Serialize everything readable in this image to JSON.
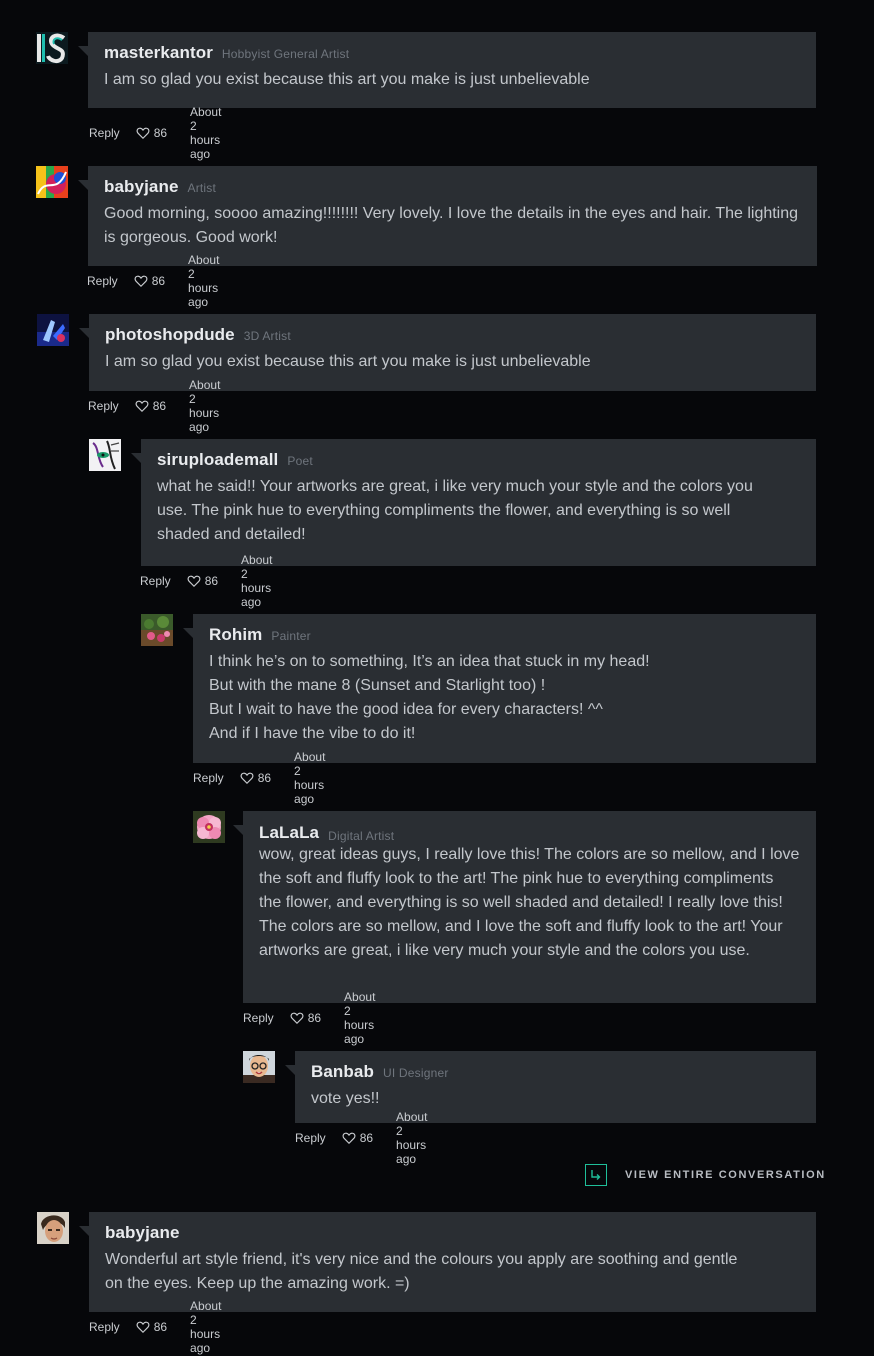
{
  "comments": [
    {
      "username": "masterkantor",
      "role": "Hobbyist General Artist",
      "text": "I am so glad you exist because this art you make is just unbelievable",
      "reply_label": "Reply",
      "likes": "86",
      "time": "About 2 hours ago",
      "avatar": "ls-logo-avatar"
    },
    {
      "username": "babyjane",
      "role": "Artist",
      "text": "Good morning, soooo amazing!!!!!!!! Very lovely.  I love the details in the eyes and hair. The lighting is gorgeous. Good work!",
      "reply_label": "Reply",
      "likes": "86",
      "time": "About 2 hours ago",
      "avatar": "rainbow-avatar"
    },
    {
      "username": "photoshopdude",
      "role": "3D Artist",
      "text": "I am so glad you exist because this art you make is just unbelievable",
      "reply_label": "Reply",
      "likes": "86",
      "time": "About 2 hours ago",
      "avatar": "blue-art-avatar"
    },
    {
      "username": "siruploadema ll",
      "role": "Poet",
      "text": "what he said!! Your artworks are great, i like very much your style and the colors you use. The pink hue to everything compliments the flower, and everything is so well shaded and detailed!",
      "reply_label": "Reply",
      "likes": "86",
      "time": "About 2 hours ago",
      "avatar": "sketch-face-avatar"
    },
    {
      "username": "Rohim",
      "role": "Painter",
      "text": "I think he’s on to something, It’s an idea that stuck in my head!\nBut with the mane 8 (Sunset and Starlight too) !\nBut I wait to have the good idea for every characters! ^^\nAnd if I have the vibe to do it!",
      "reply_label": "Reply",
      "likes": "86",
      "time": "About 2 hours ago",
      "avatar": "flowers-avatar"
    },
    {
      "username": "LaLaLa",
      "role": "Digital Artist",
      "text": "wow, great ideas guys, I really love this! The colors are so mellow, and I love the soft and fluffy look to the art! The pink hue to everything compliments the flower, and everything is so well shaded and detailed! I really love this! The colors are so mellow, and I love the soft and fluffy look to the art! Your artworks are great, i like very much your style and the colors you use.",
      "reply_label": "Reply",
      "likes": "86",
      "time": "About 2 hours ago",
      "avatar": "pink-flower-avatar"
    },
    {
      "username": "Banbab",
      "role": "UI Designer",
      "text": "vote yes!!",
      "reply_label": "Reply",
      "likes": "86",
      "time": "About 2 hours ago",
      "avatar": "glasses-person-avatar"
    },
    {
      "username": "babyjane",
      "role": "",
      "text": "Wonderful art style friend, it's very nice and the colours you apply are soothing and gentle on the eyes. Keep up the amazing work. =)",
      "reply_label": "Reply",
      "likes": "86",
      "time": "About 2 hours ago",
      "avatar": "portrait-avatar"
    }
  ],
  "view_conversation_label": "VIEW ENTIRE CONVERSATION",
  "colors": {
    "bubble": "#2a2e33",
    "accent": "#1fbf9a",
    "background": "#06070a"
  }
}
